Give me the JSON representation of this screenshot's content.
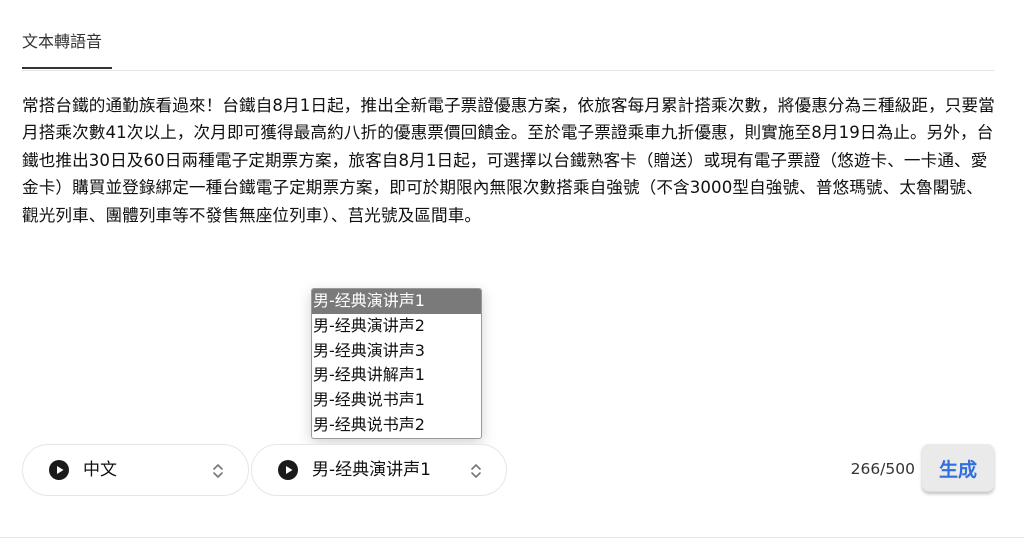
{
  "tabs": {
    "active_label": "文本轉語音"
  },
  "content": {
    "paragraph": "常搭台鐵的通勤族看過來！台鐵自8月1日起，推出全新電子票證優惠方案，依旅客每月累計搭乘次數，將優惠分為三種級距，只要當月搭乘次數41次以上，次月即可獲得最高約八折的優惠票價回饋金。至於電子票證乘車九折優惠，則實施至8月19日為止。另外，台鐵也推出30日及60日兩種電子定期票方案，旅客自8月1日起，可選擇以台鐵熟客卡（贈送）或現有電子票證（悠遊卡、一卡通、愛金卡）購買並登錄綁定一種台鐵電子定期票方案，即可於期限內無限次數搭乘自強號（不含3000型自強號、普悠瑪號、太魯閣號、觀光列車、團體列車等不發售無座位列車）、莒光號及區間車。"
  },
  "voice_dropdown": {
    "options": [
      "男-经典演讲声1",
      "男-经典演讲声2",
      "男-经典演讲声3",
      "男-经典讲解声1",
      "男-经典说书声1",
      "男-经典说书声2"
    ],
    "highlighted_index": 0
  },
  "controls": {
    "language": {
      "value": "中文",
      "icon": "play-icon"
    },
    "voice": {
      "value": "男-经典演讲声1",
      "icon": "play-icon"
    },
    "char_count": "266/500",
    "generate_label": "生成",
    "accent_color": "#2f6fde"
  }
}
